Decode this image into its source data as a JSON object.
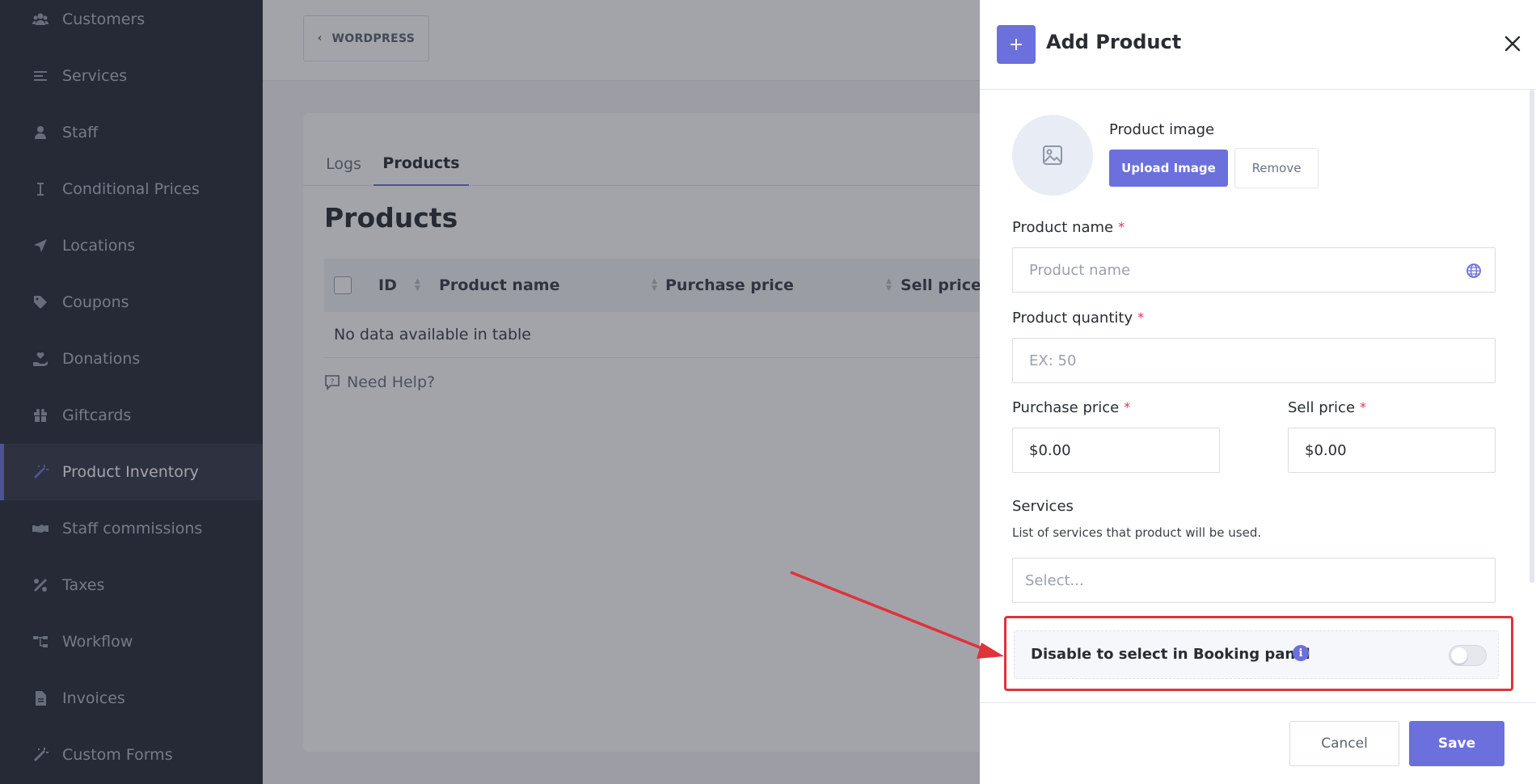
{
  "sidebar": {
    "items": [
      {
        "label": "Customers",
        "icon": "users-icon"
      },
      {
        "label": "Services",
        "icon": "list-icon"
      },
      {
        "label": "Staff",
        "icon": "user-icon"
      },
      {
        "label": "Conditional Prices",
        "icon": "text-cursor-icon"
      },
      {
        "label": "Locations",
        "icon": "location-arrow-icon"
      },
      {
        "label": "Coupons",
        "icon": "tag-icon"
      },
      {
        "label": "Donations",
        "icon": "hand-heart-icon"
      },
      {
        "label": "Giftcards",
        "icon": "gift-icon"
      },
      {
        "label": "Product Inventory",
        "icon": "magic-wand-icon",
        "active": true
      },
      {
        "label": "Staff commissions",
        "icon": "handshake-icon"
      },
      {
        "label": "Taxes",
        "icon": "percent-icon"
      },
      {
        "label": "Workflow",
        "icon": "sitemap-icon"
      },
      {
        "label": "Invoices",
        "icon": "file-icon"
      },
      {
        "label": "Custom Forms",
        "icon": "magic-wand-icon"
      }
    ]
  },
  "topbar": {
    "back_label": "WORDPRESS"
  },
  "main": {
    "tabs": [
      {
        "label": "Logs"
      },
      {
        "label": "Products",
        "active": true
      }
    ],
    "title": "Products",
    "table": {
      "columns": [
        "ID",
        "Product name",
        "Purchase price",
        "Sell price"
      ],
      "empty_text": "No data available in table"
    },
    "help_text": "Need Help?"
  },
  "modal": {
    "title": "Add Product",
    "plus": "+",
    "image_label": "Product image",
    "upload_label": "Upload Image",
    "remove_label": "Remove",
    "name_label": "Product name",
    "name_placeholder": "Product name",
    "quantity_label": "Product quantity",
    "quantity_placeholder": "EX: 50",
    "purchase_label": "Purchase price",
    "purchase_value": "$0.00",
    "sell_label": "Sell price",
    "sell_value": "$0.00",
    "services_label": "Services",
    "services_hint": "List of services that product will be used.",
    "services_placeholder": "Select...",
    "required_mark": "*",
    "toggle_label": "Disable to select in Booking panel",
    "toggle_on": false,
    "info_glyph": "i",
    "cancel_label": "Cancel",
    "save_label": "Save"
  },
  "colors": {
    "accent": "#6c70dc",
    "sidebar_bg": "#292d3b",
    "annotation_red": "#e0323b"
  }
}
